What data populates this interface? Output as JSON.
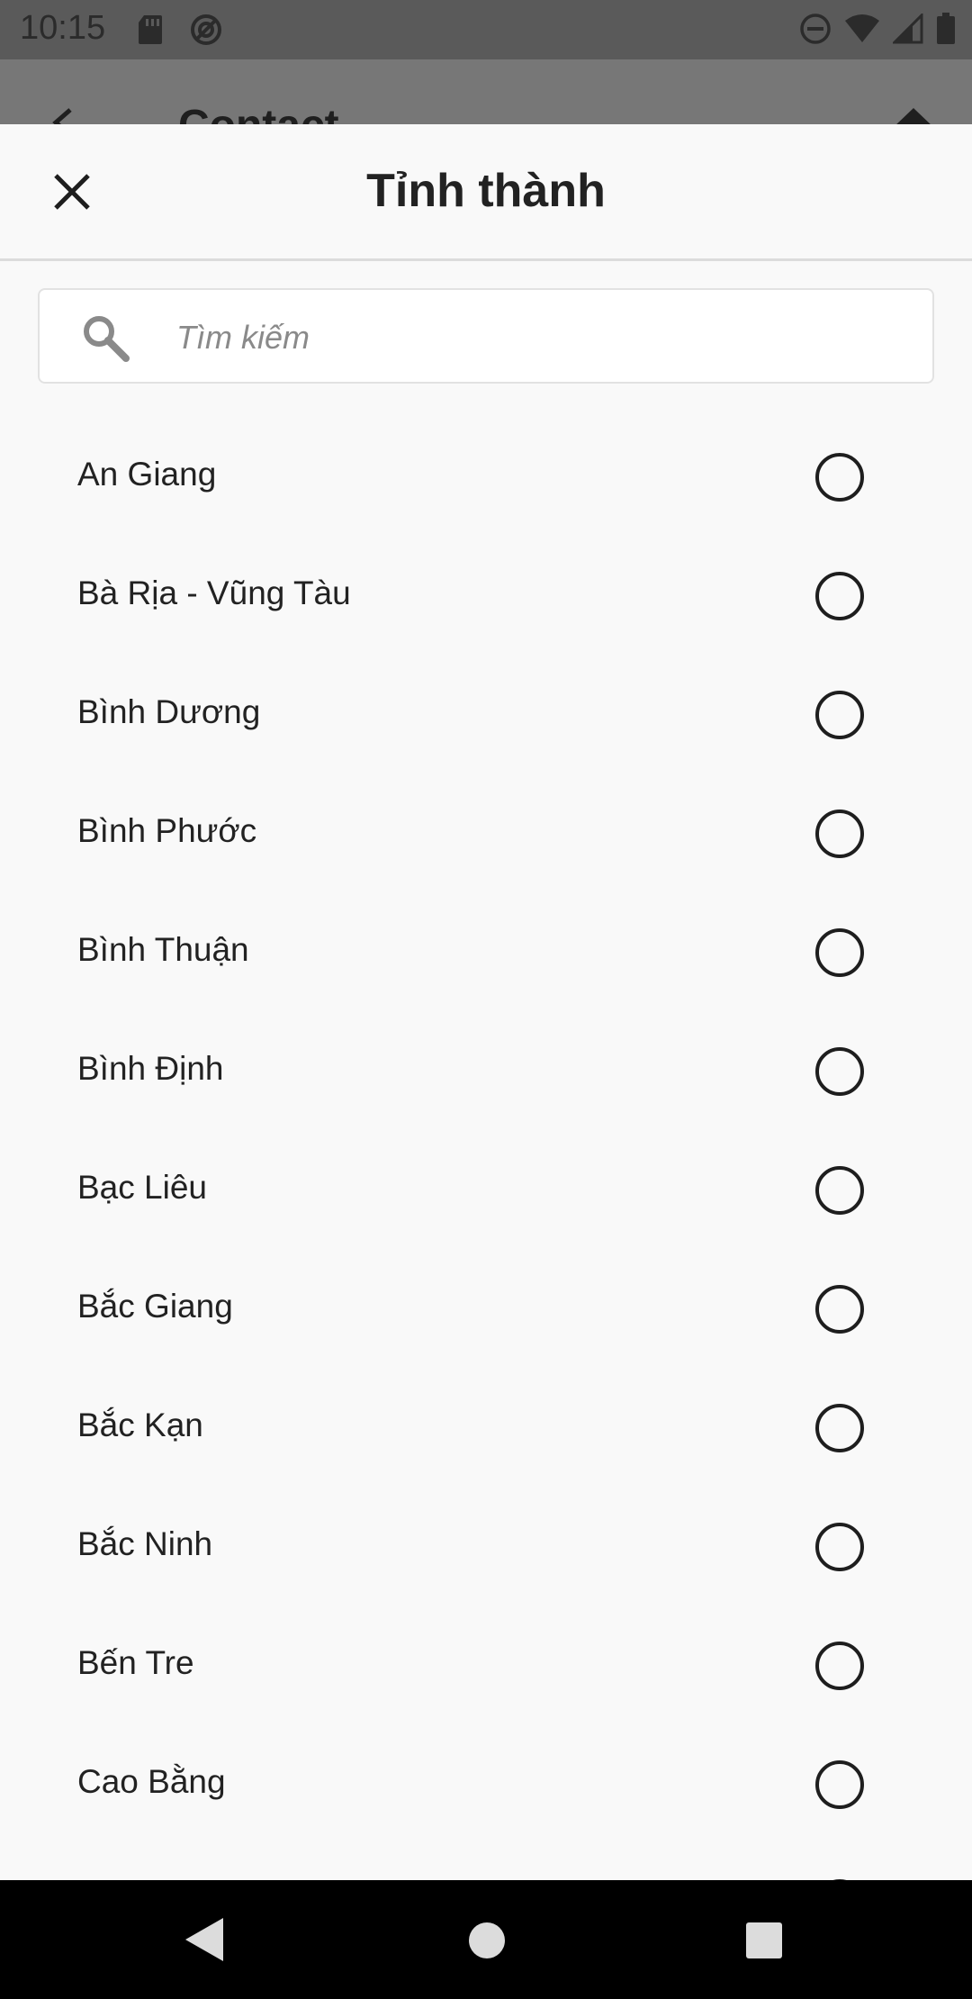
{
  "status_bar": {
    "time": "10:15",
    "icons_left": [
      "sd-card-icon",
      "sync-icon"
    ],
    "icons_right": [
      "dnd-icon",
      "wifi-icon",
      "signal-icon",
      "battery-icon"
    ]
  },
  "background_screen": {
    "title": "Contact"
  },
  "sheet": {
    "title": "Tỉnh thành",
    "search": {
      "placeholder": "Tìm kiếm",
      "value": ""
    },
    "provinces": [
      {
        "label": "An Giang",
        "selected": false
      },
      {
        "label": "Bà Rịa - Vũng Tàu",
        "selected": false
      },
      {
        "label": "Bình Dương",
        "selected": false
      },
      {
        "label": "Bình Phước",
        "selected": false
      },
      {
        "label": "Bình Thuận",
        "selected": false
      },
      {
        "label": "Bình Định",
        "selected": false
      },
      {
        "label": "Bạc Liêu",
        "selected": false
      },
      {
        "label": "Bắc Giang",
        "selected": false
      },
      {
        "label": "Bắc Kạn",
        "selected": false
      },
      {
        "label": "Bắc Ninh",
        "selected": false
      },
      {
        "label": "Bến Tre",
        "selected": false
      },
      {
        "label": "Cao Bằng",
        "selected": false
      },
      {
        "label": "",
        "selected": false
      }
    ]
  },
  "colors": {
    "sheet_background": "#f9f9f9",
    "scrim": "#777777",
    "status_bar": "#5a5a5a",
    "text": "#222222",
    "radio_border": "#1e1e1e",
    "nav_bar": "#000000"
  },
  "nav_bar": {
    "buttons": [
      "back-icon",
      "home-icon",
      "recents-icon"
    ]
  }
}
